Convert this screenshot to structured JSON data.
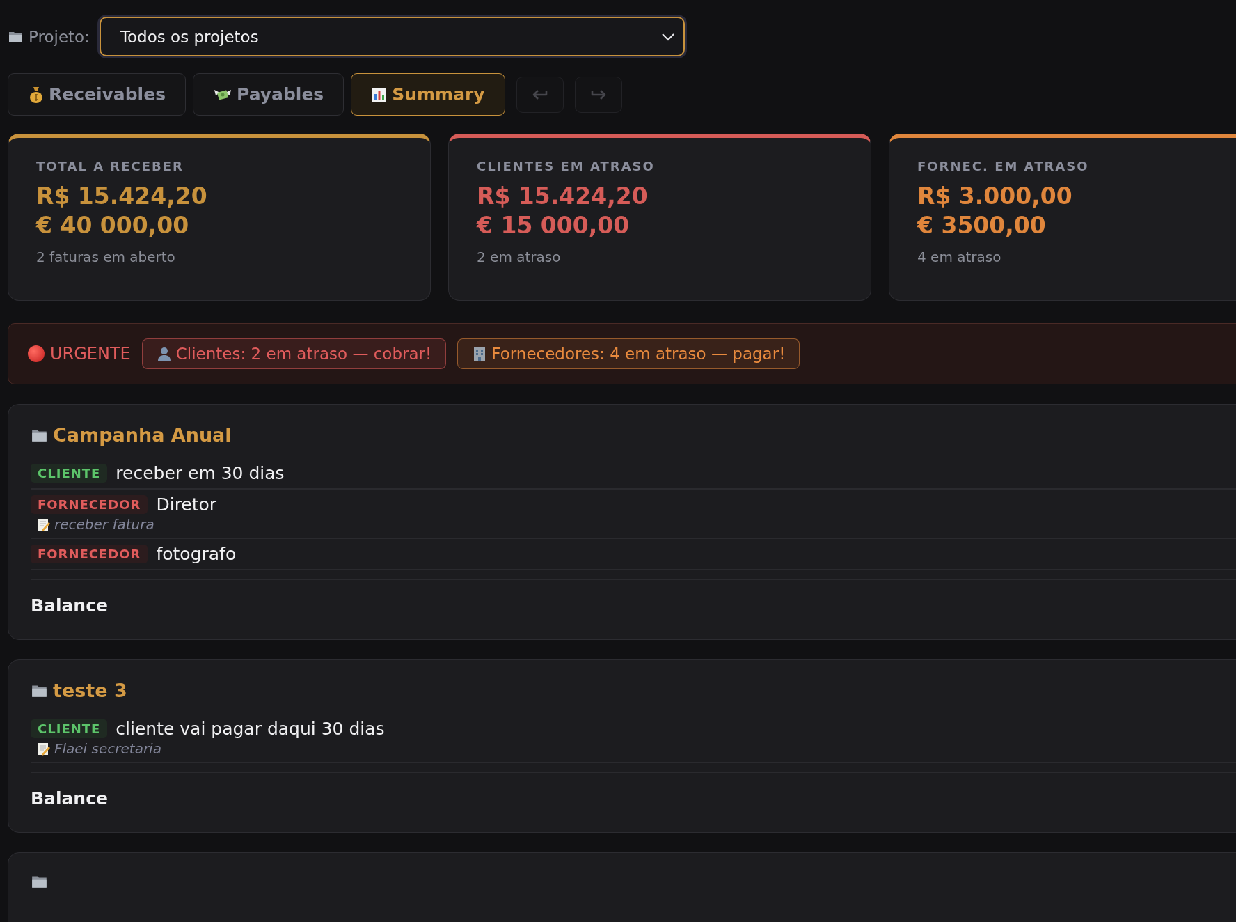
{
  "project_filter": {
    "label": "Projeto:",
    "value": "Todos os projetos"
  },
  "tabs": [
    {
      "label": "Receivables",
      "kind": "receivables",
      "selected": false
    },
    {
      "label": "Payables",
      "kind": "payables",
      "selected": false
    },
    {
      "label": "Summary",
      "kind": "summary",
      "selected": true
    }
  ],
  "history_buttons": [
    {
      "kind": "undo",
      "disabled": true
    },
    {
      "kind": "redo",
      "disabled": true
    }
  ],
  "summary_cards": [
    {
      "label": "TOTAL A RECEBER",
      "amounts": [
        "R$ 15.424,20",
        "€ 40 000,00"
      ],
      "caption": "2 faturas em aberto",
      "color": "#c8923c"
    },
    {
      "label": "CLIENTES EM ATRASO",
      "amounts": [
        "R$ 15.424,20",
        "€ 15 000,00"
      ],
      "caption": "2 em atraso",
      "color": "#d65c58"
    },
    {
      "label": "FORNEC. EM ATRASO",
      "amounts": [
        "R$ 3.000,00",
        "€ 3500,00"
      ],
      "caption": "4 em atraso",
      "color": "#e0863c"
    }
  ],
  "alert": {
    "label": "URGENTE",
    "badges": [
      {
        "kind": "clients",
        "text": "Clientes: 2 em atraso — cobrar!",
        "color": "#e05c5c"
      },
      {
        "kind": "suppliers",
        "text": "Fornecedores: 4 em atraso — pagar!",
        "color": "#e88a3e"
      }
    ]
  },
  "projects": [
    {
      "name": "Campanha Anual",
      "entries": [
        {
          "kind": "client",
          "tag": "CLIENTE",
          "text": "receber em 30 dias"
        },
        {
          "kind": "supplier",
          "tag": "FORNECEDOR",
          "text": "Diretor",
          "note": "receber fatura"
        },
        {
          "kind": "supplier",
          "tag": "FORNECEDOR",
          "text": "fotografo"
        }
      ],
      "balance_label": "Balance"
    },
    {
      "name": "teste 3",
      "entries": [
        {
          "kind": "client",
          "tag": "CLIENTE",
          "text": "cliente vai pagar daqui 30 dias",
          "note": "Flaei secretaria"
        }
      ],
      "balance_label": "Balance"
    }
  ]
}
